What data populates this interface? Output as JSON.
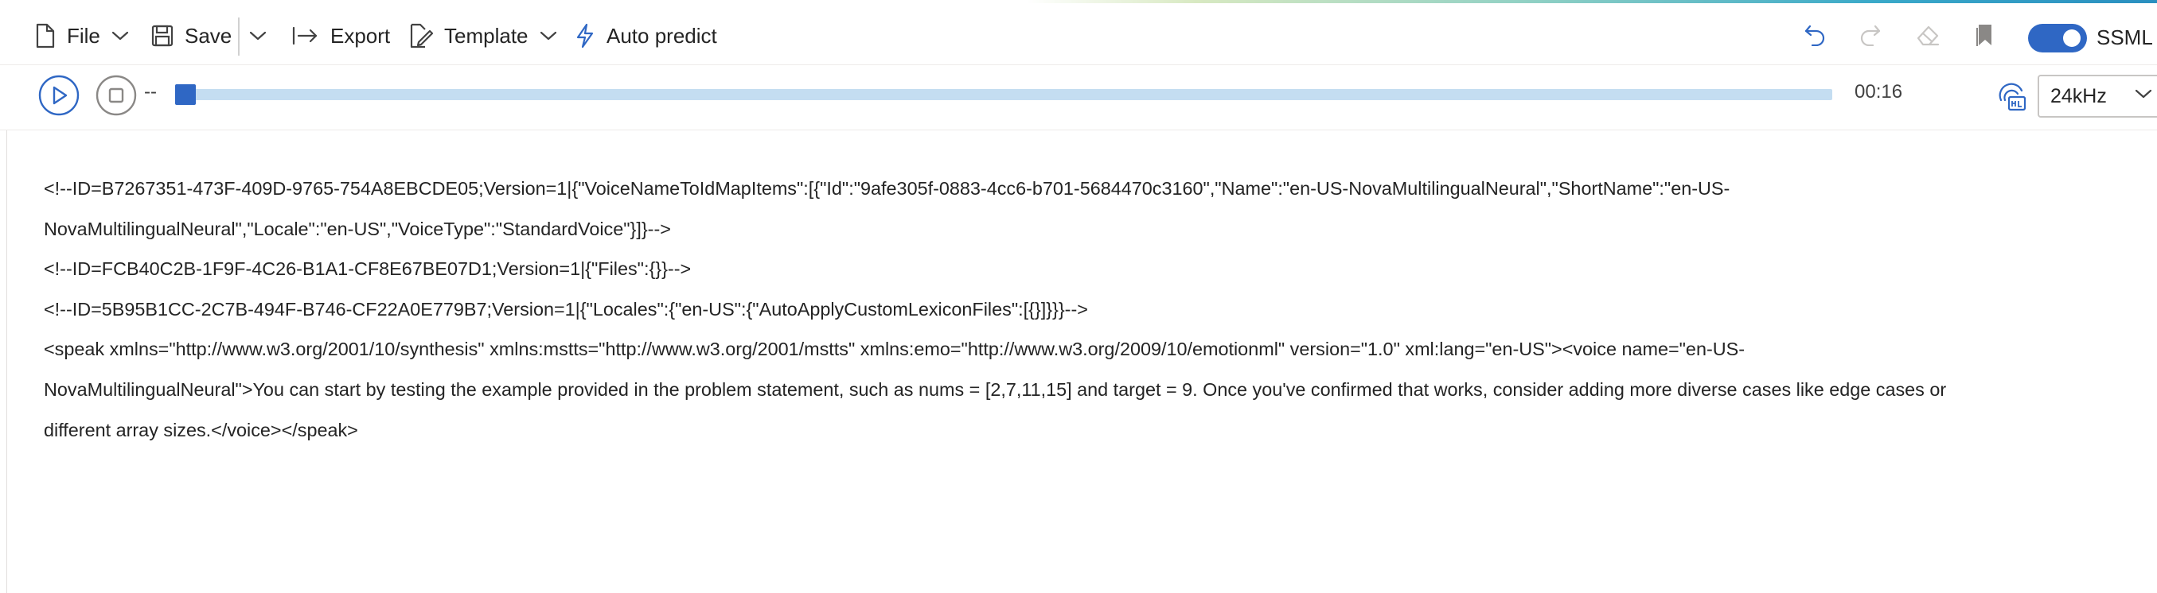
{
  "toolbar": {
    "file_label": "File",
    "save_label": "Save",
    "export_label": "Export",
    "template_label": "Template",
    "auto_predict_label": "Auto predict",
    "ssml_toggle": {
      "label": "SSML",
      "on": true
    }
  },
  "player": {
    "current_time": "--",
    "duration": "00:16",
    "progress": 0,
    "sample_rate": "24kHz"
  },
  "colors": {
    "accent": "#2f67c4",
    "track": "#c4ddf1",
    "text": "#242424"
  },
  "icons": [
    "file-icon",
    "save-icon",
    "chevron-down-icon",
    "export-icon",
    "template-icon",
    "auto-predict-icon",
    "undo-icon",
    "redo-icon",
    "eraser-icon",
    "bookmark-icon",
    "play-icon",
    "stop-icon",
    "high-quality-icon"
  ],
  "editor": {
    "lines": [
      "<!--ID=B7267351-473F-409D-9765-754A8EBCDE05;Version=1|{\"VoiceNameToIdMapItems\":[{\"Id\":\"9afe305f-0883-4cc6-b701-5684470c3160\",\"Name\":\"en-US-NovaMultilingualNeural\",\"ShortName\":\"en-US-",
      "NovaMultilingualNeural\",\"Locale\":\"en-US\",\"VoiceType\":\"StandardVoice\"}]}-->",
      "<!--ID=FCB40C2B-1F9F-4C26-B1A1-CF8E67BE07D1;Version=1|{\"Files\":{}}-->",
      "<!--ID=5B95B1CC-2C7B-494F-B746-CF22A0E779B7;Version=1|{\"Locales\":{\"en-US\":{\"AutoApplyCustomLexiconFiles\":[{}]}}}-->",
      "<speak xmlns=\"http://www.w3.org/2001/10/synthesis\" xmlns:mstts=\"http://www.w3.org/2001/mstts\" xmlns:emo=\"http://www.w3.org/2009/10/emotionml\" version=\"1.0\" xml:lang=\"en-US\"><voice name=\"en-US-",
      "NovaMultilingualNeural\">You can start by testing the example provided in the problem statement, such as nums = [2,7,11,15] and target = 9. Once you've confirmed that works, consider adding more diverse cases like edge cases or",
      "different array sizes.</voice></speak>"
    ]
  }
}
